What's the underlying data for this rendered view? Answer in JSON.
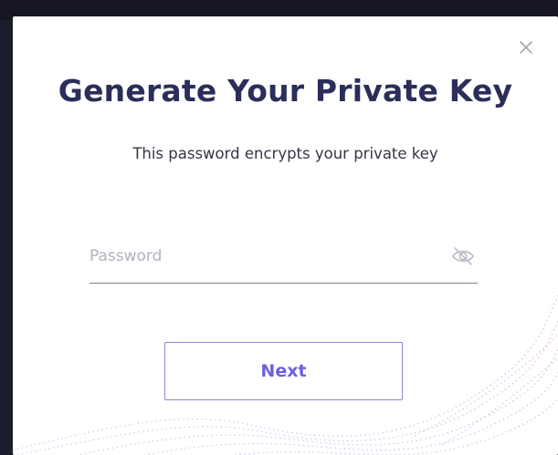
{
  "dialog": {
    "title": "Generate Your Private Key",
    "subtitle": "This password encrypts your private key",
    "password_placeholder": "Password",
    "password_value": "",
    "next_label": "Next",
    "close_icon": "close-icon",
    "visibility_icon": "eye-off-icon"
  },
  "colors": {
    "title": "#2b2d5a",
    "accent": "#6d5fe0",
    "button_border": "#8b86e0",
    "background": "#1c1d2b"
  }
}
